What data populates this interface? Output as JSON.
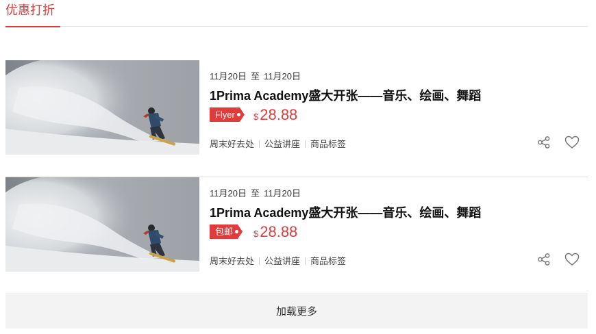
{
  "tab": {
    "label": "优惠打折"
  },
  "items": [
    {
      "date_from": "11月20日",
      "date_sep": "至",
      "date_to": "11月20日",
      "title": "1Prima Academy盛大开张——音乐、绘画、舞蹈",
      "tag": "Flyer",
      "currency": "$",
      "price": "28.88",
      "labels": [
        "周末好去处",
        "公益讲座",
        "商品标签"
      ]
    },
    {
      "date_from": "11月20日",
      "date_sep": "至",
      "date_to": "11月20日",
      "title": "1Prima Academy盛大开张——音乐、绘画、舞蹈",
      "tag": "包邮",
      "currency": "$",
      "price": "28.88",
      "labels": [
        "周末好去处",
        "公益讲座",
        "商品标签"
      ]
    }
  ],
  "load_more": "加载更多",
  "colors": {
    "accent": "#e03c3c",
    "divider": "#e4e4e4",
    "button_bg": "#f3f3f3"
  },
  "icons": [
    "share-icon",
    "heart-icon"
  ]
}
